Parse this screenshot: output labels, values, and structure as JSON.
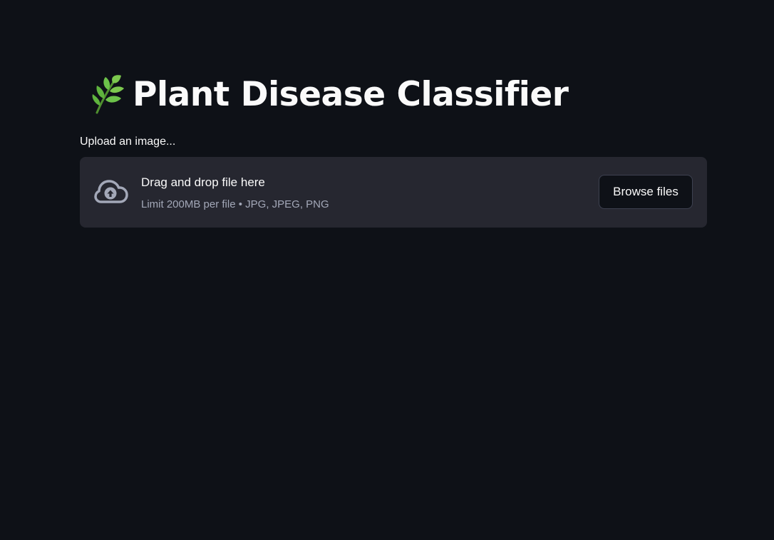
{
  "header": {
    "icon": "herb-icon",
    "title": "Plant Disease Classifier"
  },
  "uploader": {
    "label": "Upload an image...",
    "icon": "cloud-upload-icon",
    "drop_title": "Drag and drop file here",
    "drop_hint": "Limit 200MB per file • JPG, JPEG, PNG",
    "browse_label": "Browse files"
  },
  "colors": {
    "background": "#0e1117",
    "dropzone": "#262730",
    "text": "#fafafa",
    "muted_text": "#a3a8b8",
    "leaf_green": "#6cc24a"
  }
}
